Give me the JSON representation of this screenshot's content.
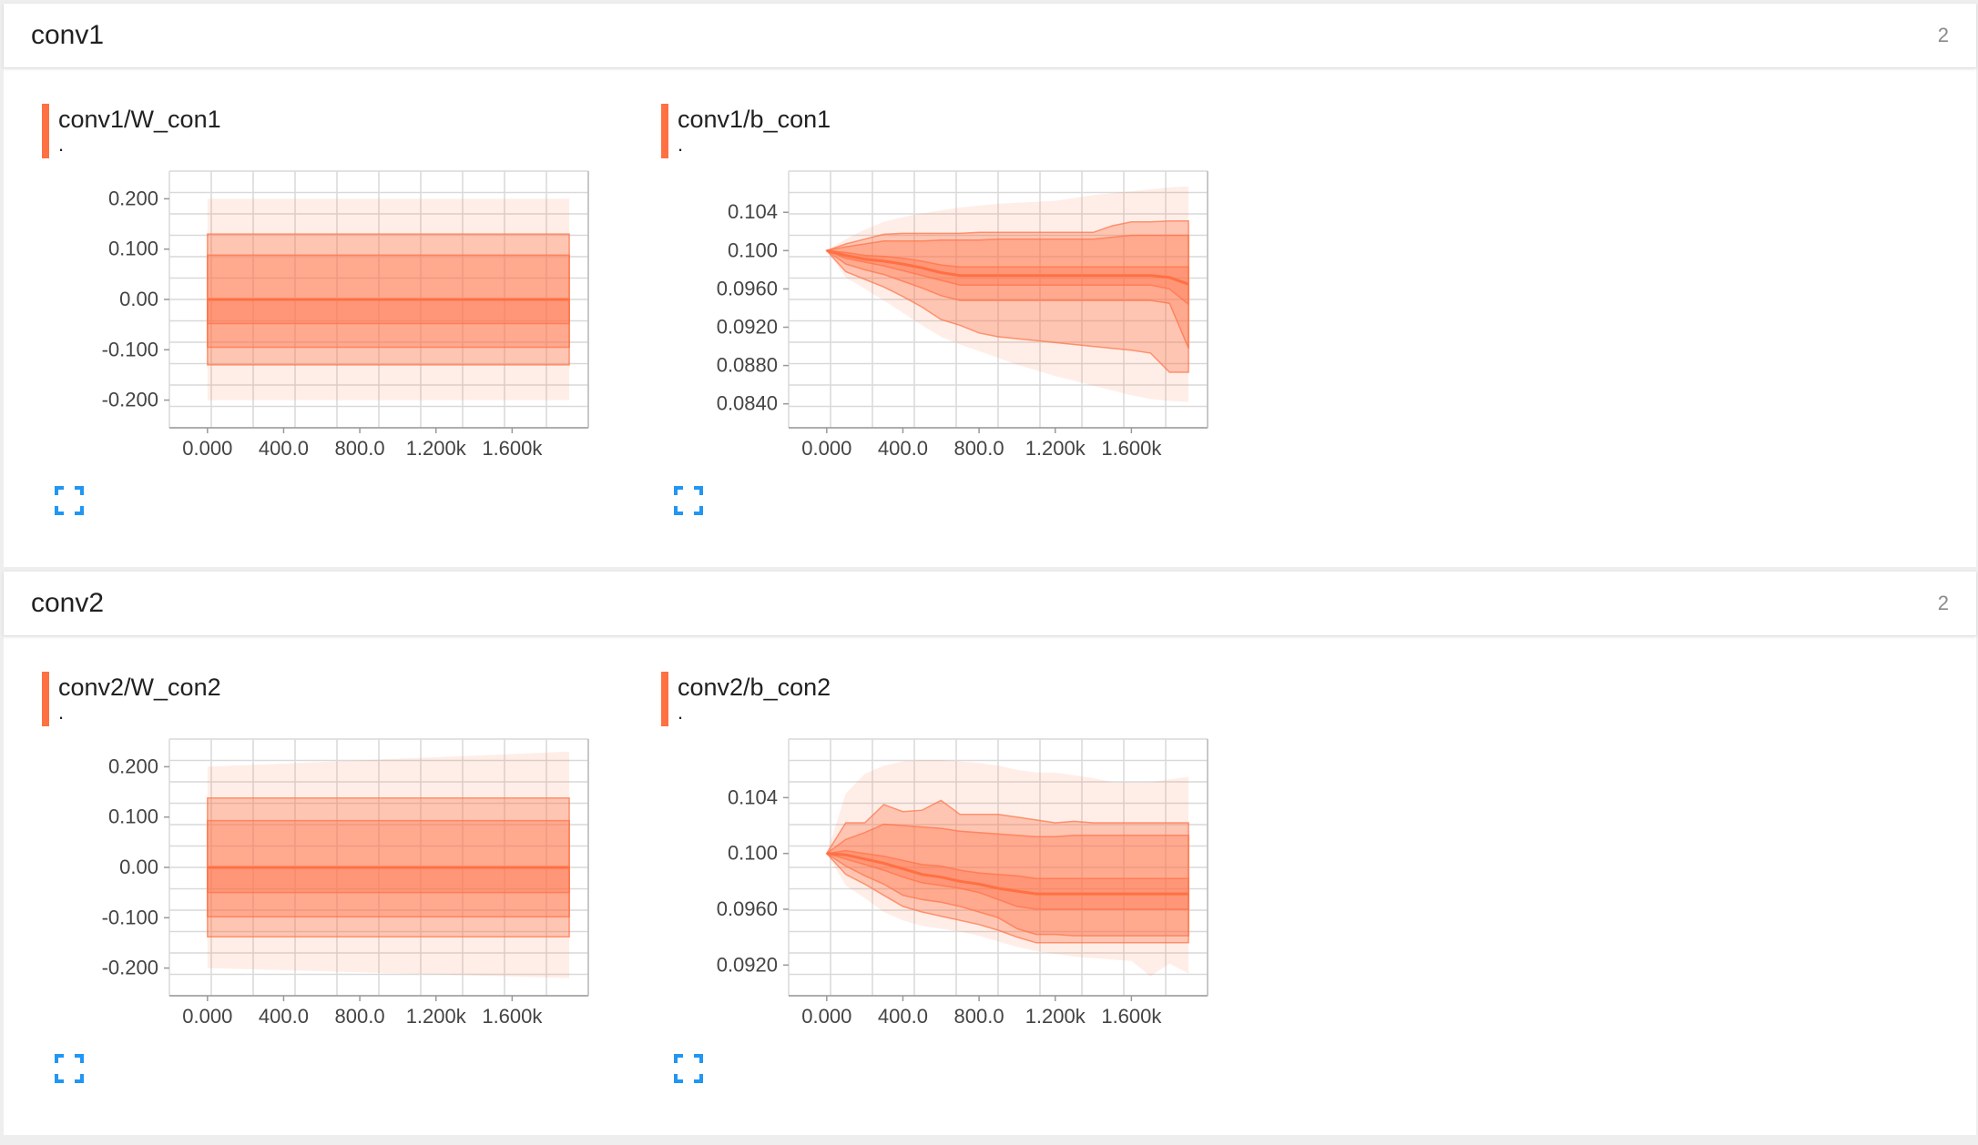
{
  "accent_color": "#ff7043",
  "sections": [
    {
      "title": "conv1",
      "count": "2",
      "cards": [
        {
          "title": "conv1/W_con1",
          "subtitle": ".",
          "expand_icon": "fullscreen-icon",
          "chart_data": {
            "type": "area",
            "x_ticks": [
              "0.000",
              "400.0",
              "800.0",
              "1.200k",
              "1.600k"
            ],
            "x_tick_values": [
              0,
              400,
              800,
              1200,
              1600
            ],
            "y_ticks": [
              "0.200",
              "0.100",
              "0.00",
              "-0.100",
              "-0.200"
            ],
            "y_tick_values": [
              0.2,
              0.1,
              0.0,
              -0.1,
              -0.2
            ],
            "xlim": [
              -200,
              2000
            ],
            "ylim": [
              -0.255,
              0.255
            ],
            "x": [
              0,
              1900
            ],
            "bands": [
              {
                "opacity": 0.12,
                "upper": [
                  0.2,
                  0.2
                ],
                "lower": [
                  -0.2,
                  -0.2
                ]
              },
              {
                "opacity": 0.32,
                "upper": [
                  0.13,
                  0.13
                ],
                "lower": [
                  -0.13,
                  -0.13
                ]
              },
              {
                "opacity": 0.32,
                "upper": [
                  0.088,
                  0.088
                ],
                "lower": [
                  -0.095,
                  -0.095
                ]
              },
              {
                "opacity": 0.32,
                "upper": [
                  0.0,
                  0.0
                ],
                "lower": [
                  -0.048,
                  -0.048
                ]
              }
            ],
            "median": [
              0.0,
              0.0
            ],
            "grid": true
          }
        },
        {
          "title": "conv1/b_con1",
          "subtitle": ".",
          "expand_icon": "fullscreen-icon",
          "chart_data": {
            "type": "area",
            "x_ticks": [
              "0.000",
              "400.0",
              "800.0",
              "1.200k",
              "1.600k"
            ],
            "x_tick_values": [
              0,
              400,
              800,
              1200,
              1600
            ],
            "y_ticks": [
              "0.104",
              "0.100",
              "0.0960",
              "0.0920",
              "0.0880",
              "0.0840"
            ],
            "y_tick_values": [
              0.104,
              0.1,
              0.096,
              0.092,
              0.088,
              0.084
            ],
            "xlim": [
              -200,
              2000
            ],
            "ylim": [
              0.0815,
              0.1083
            ],
            "x": [
              0,
              100,
              200,
              300,
              400,
              500,
              600,
              700,
              800,
              900,
              1000,
              1100,
              1200,
              1300,
              1400,
              1500,
              1600,
              1700,
              1800,
              1900
            ],
            "bands": [
              {
                "opacity": 0.12,
                "upper": [
                  0.1,
                  0.1012,
                  0.1022,
                  0.103,
                  0.1035,
                  0.1039,
                  0.1042,
                  0.1045,
                  0.1047,
                  0.1049,
                  0.105,
                  0.1051,
                  0.1052,
                  0.1055,
                  0.1058,
                  0.106,
                  0.1062,
                  0.1064,
                  0.1066,
                  0.1067
                ],
                "lower": [
                  0.1,
                  0.0972,
                  0.096,
                  0.0948,
                  0.0935,
                  0.0922,
                  0.091,
                  0.0902,
                  0.0895,
                  0.0888,
                  0.0881,
                  0.0875,
                  0.0869,
                  0.0864,
                  0.0859,
                  0.0854,
                  0.0849,
                  0.0845,
                  0.0843,
                  0.0842
                ]
              },
              {
                "opacity": 0.32,
                "upper": [
                  0.1,
                  0.1007,
                  0.1012,
                  0.1017,
                  0.1018,
                  0.1018,
                  0.1018,
                  0.1018,
                  0.1019,
                  0.1019,
                  0.1019,
                  0.1019,
                  0.1019,
                  0.1019,
                  0.1019,
                  0.1026,
                  0.103,
                  0.103,
                  0.1031,
                  0.1031
                ],
                "lower": [
                  0.1,
                  0.0978,
                  0.097,
                  0.0962,
                  0.0952,
                  0.0941,
                  0.0928,
                  0.0922,
                  0.0914,
                  0.091,
                  0.0908,
                  0.0906,
                  0.0904,
                  0.0902,
                  0.09,
                  0.0898,
                  0.0896,
                  0.0893,
                  0.0873,
                  0.0873
                ]
              },
              {
                "opacity": 0.32,
                "upper": [
                  0.1,
                  0.1004,
                  0.1007,
                  0.101,
                  0.101,
                  0.101,
                  0.1011,
                  0.1011,
                  0.1011,
                  0.1012,
                  0.1012,
                  0.1012,
                  0.1012,
                  0.1012,
                  0.1012,
                  0.1014,
                  0.1016,
                  0.1016,
                  0.1016,
                  0.1016
                ],
                "lower": [
                  0.1,
                  0.0986,
                  0.098,
                  0.0975,
                  0.0968,
                  0.0961,
                  0.0953,
                  0.0948,
                  0.0948,
                  0.0948,
                  0.0948,
                  0.0948,
                  0.0948,
                  0.0948,
                  0.0948,
                  0.0948,
                  0.0948,
                  0.0948,
                  0.0945,
                  0.0898
                ]
              },
              {
                "opacity": 0.32,
                "upper": [
                  0.1,
                  0.0998,
                  0.0995,
                  0.0994,
                  0.0992,
                  0.0989,
                  0.0985,
                  0.0983,
                  0.0983,
                  0.0983,
                  0.0983,
                  0.0983,
                  0.0983,
                  0.0983,
                  0.0983,
                  0.0983,
                  0.0983,
                  0.0983,
                  0.0983,
                  0.0983
                ],
                "lower": [
                  0.1,
                  0.0992,
                  0.0988,
                  0.0984,
                  0.0979,
                  0.0974,
                  0.0969,
                  0.0964,
                  0.0964,
                  0.0964,
                  0.0964,
                  0.0964,
                  0.0964,
                  0.0964,
                  0.0964,
                  0.0964,
                  0.0964,
                  0.0964,
                  0.096,
                  0.0944
                ]
              }
            ],
            "median": [
              0.1,
              0.0995,
              0.0991,
              0.0989,
              0.0986,
              0.0982,
              0.0977,
              0.0974,
              0.0974,
              0.0974,
              0.0974,
              0.0974,
              0.0974,
              0.0974,
              0.0974,
              0.0974,
              0.0974,
              0.0974,
              0.0972,
              0.0965
            ],
            "grid": true
          }
        }
      ]
    },
    {
      "title": "conv2",
      "count": "2",
      "cards": [
        {
          "title": "conv2/W_con2",
          "subtitle": ".",
          "expand_icon": "fullscreen-icon",
          "chart_data": {
            "type": "area",
            "x_ticks": [
              "0.000",
              "400.0",
              "800.0",
              "1.200k",
              "1.600k"
            ],
            "x_tick_values": [
              0,
              400,
              800,
              1200,
              1600
            ],
            "y_ticks": [
              "0.200",
              "0.100",
              "0.00",
              "-0.100",
              "-0.200"
            ],
            "y_tick_values": [
              0.2,
              0.1,
              0.0,
              -0.1,
              -0.2
            ],
            "xlim": [
              -200,
              2000
            ],
            "ylim": [
              -0.255,
              0.255
            ],
            "x": [
              0,
              1900
            ],
            "bands": [
              {
                "opacity": 0.12,
                "upper": [
                  0.2,
                  0.23
                ],
                "lower": [
                  -0.2,
                  -0.22
                ]
              },
              {
                "opacity": 0.32,
                "upper": [
                  0.138,
                  0.138
                ],
                "lower": [
                  -0.138,
                  -0.138
                ]
              },
              {
                "opacity": 0.32,
                "upper": [
                  0.093,
                  0.093
                ],
                "lower": [
                  -0.098,
                  -0.098
                ]
              },
              {
                "opacity": 0.32,
                "upper": [
                  0.0,
                  0.0
                ],
                "lower": [
                  -0.05,
                  -0.05
                ]
              }
            ],
            "median": [
              0.0,
              0.0
            ],
            "grid": true
          }
        },
        {
          "title": "conv2/b_con2",
          "subtitle": ".",
          "expand_icon": "fullscreen-icon",
          "chart_data": {
            "type": "area",
            "x_ticks": [
              "0.000",
              "400.0",
              "800.0",
              "1.200k",
              "1.600k"
            ],
            "x_tick_values": [
              0,
              400,
              800,
              1200,
              1600
            ],
            "y_ticks": [
              "0.104",
              "0.100",
              "0.0960",
              "0.0920"
            ],
            "y_tick_values": [
              0.104,
              0.1,
              0.096,
              0.092
            ],
            "xlim": [
              -200,
              2000
            ],
            "ylim": [
              0.0898,
              0.1082
            ],
            "x": [
              0,
              100,
              200,
              300,
              400,
              500,
              600,
              700,
              800,
              900,
              1000,
              1100,
              1200,
              1300,
              1400,
              1500,
              1600,
              1700,
              1800,
              1900
            ],
            "bands": [
              {
                "opacity": 0.12,
                "upper": [
                  0.1,
                  0.1043,
                  0.1057,
                  0.1063,
                  0.1066,
                  0.1067,
                  0.1067,
                  0.1066,
                  0.1065,
                  0.1063,
                  0.106,
                  0.1058,
                  0.1058,
                  0.1056,
                  0.1054,
                  0.1051,
                  0.1051,
                  0.1051,
                  0.1053,
                  0.1055
                ],
                "lower": [
                  0.1,
                  0.0977,
                  0.0968,
                  0.0958,
                  0.0952,
                  0.0948,
                  0.0946,
                  0.0944,
                  0.0941,
                  0.0937,
                  0.0933,
                  0.093,
                  0.0928,
                  0.0926,
                  0.0925,
                  0.0924,
                  0.0923,
                  0.0912,
                  0.0921,
                  0.0914
                ]
              },
              {
                "opacity": 0.32,
                "upper": [
                  0.1,
                  0.1022,
                  0.1022,
                  0.1035,
                  0.103,
                  0.1031,
                  0.1038,
                  0.1028,
                  0.1028,
                  0.1028,
                  0.1026,
                  0.1024,
                  0.1022,
                  0.1023,
                  0.1022,
                  0.1022,
                  0.1022,
                  0.1022,
                  0.1022,
                  0.1022
                ],
                "lower": [
                  0.1,
                  0.0985,
                  0.0978,
                  0.097,
                  0.0962,
                  0.0958,
                  0.0955,
                  0.0952,
                  0.0949,
                  0.0945,
                  0.094,
                  0.0936,
                  0.0936,
                  0.0936,
                  0.0936,
                  0.0936,
                  0.0936,
                  0.0936,
                  0.0936,
                  0.0936
                ]
              },
              {
                "opacity": 0.32,
                "upper": [
                  0.1,
                  0.101,
                  0.1015,
                  0.1021,
                  0.102,
                  0.1019,
                  0.1018,
                  0.1016,
                  0.1015,
                  0.1014,
                  0.1013,
                  0.1012,
                  0.1012,
                  0.1013,
                  0.1013,
                  0.1013,
                  0.1013,
                  0.1013,
                  0.1013,
                  0.1013
                ],
                "lower": [
                  0.1,
                  0.0991,
                  0.0984,
                  0.0978,
                  0.097,
                  0.0967,
                  0.0965,
                  0.0962,
                  0.0958,
                  0.0954,
                  0.0946,
                  0.0942,
                  0.0942,
                  0.0941,
                  0.0941,
                  0.0941,
                  0.0941,
                  0.0941,
                  0.0941,
                  0.0941
                ]
              },
              {
                "opacity": 0.32,
                "upper": [
                  0.1,
                  0.1002,
                  0.1,
                  0.0998,
                  0.0995,
                  0.0992,
                  0.0991,
                  0.0988,
                  0.0986,
                  0.0985,
                  0.0984,
                  0.0982,
                  0.0982,
                  0.0982,
                  0.0982,
                  0.0982,
                  0.0982,
                  0.0982,
                  0.0982,
                  0.0982
                ],
                "lower": [
                  0.1,
                  0.0996,
                  0.0992,
                  0.0988,
                  0.0983,
                  0.0979,
                  0.0977,
                  0.0975,
                  0.0972,
                  0.0967,
                  0.0962,
                  0.096,
                  0.096,
                  0.096,
                  0.096,
                  0.096,
                  0.096,
                  0.096,
                  0.096,
                  0.096
                ]
              }
            ],
            "median": [
              0.1,
              0.0999,
              0.0996,
              0.0993,
              0.0989,
              0.0985,
              0.0983,
              0.098,
              0.0978,
              0.0975,
              0.0973,
              0.0971,
              0.0971,
              0.0971,
              0.0971,
              0.0971,
              0.0971,
              0.0971,
              0.0971,
              0.0971
            ],
            "grid": true
          }
        }
      ]
    }
  ]
}
